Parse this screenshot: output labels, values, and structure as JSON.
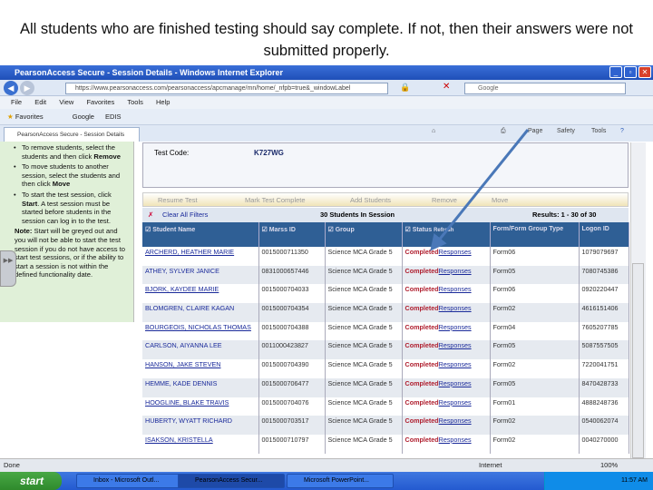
{
  "caption": "All students who are finished testing should say complete.  If not, then their answers were not submitted properly.",
  "browser": {
    "title": "PearsonAccess Secure - Session Details - Windows Internet Explorer",
    "url": "https://www.pearsonaccess.com/pearsonaccess/apcmanage/mn/home/_nfpb=true&_windowLabel",
    "search_placeholder": "Google",
    "menu": [
      "File",
      "Edit",
      "View",
      "Favorites",
      "Tools",
      "Help"
    ],
    "favorites": {
      "label": "Favorites",
      "items": [
        "Google",
        "EDIS"
      ]
    },
    "tab": "PearsonAccess Secure - Session Details",
    "commands": [
      "Page",
      "Safety",
      "Tools"
    ],
    "status": "Done",
    "zone": "Internet",
    "zoom": "100%"
  },
  "sidebar": {
    "items": [
      {
        "text": "To remove students, select the students and then click ",
        "bold": "Remove"
      },
      {
        "text": "To move students to another session, select the students and then click ",
        "bold": "Move"
      },
      {
        "text": "To start the test session, click ",
        "bold": "Start",
        "after": ". A test session must be started before students in the session can log in to the test."
      }
    ],
    "note_label": "Note:",
    "note": " Start will be greyed out and you will not be able to start the test session if you do not have access to start test sessions, or if the ability to start a session is not within the defined functionality date."
  },
  "session": {
    "test_code_label": "Test Code:",
    "test_code": "K727WG"
  },
  "toolbar": [
    "Resume Test",
    "Mark Test Complete",
    "Add Students",
    "Remove",
    "Move"
  ],
  "filters": {
    "clear": "Clear All Filters",
    "count": "30 Students In Session",
    "results": "Results: 1 - 30 of 30"
  },
  "columns": [
    "Student Name",
    "Marss ID",
    "Group",
    "Status",
    "Form/Form Group Type",
    "Logon ID"
  ],
  "refresh": "Refresh",
  "rows": [
    {
      "name": "ARCHERD, HEATHER MARIE",
      "id": "0015000711350",
      "group": "Science MCA Grade 5",
      "status": "Completed",
      "link": "Responses",
      "form": "Form06",
      "logon": "1079079697"
    },
    {
      "name": "ATHEY, SYLVER JANICE",
      "id": "0831000657446",
      "group": "Science MCA Grade 5",
      "status": "Completed",
      "link": "Responses",
      "form": "Form05",
      "logon": "7080745386"
    },
    {
      "name": "BJORK, KAYDEE MARIE",
      "id": "0015000704033",
      "group": "Science MCA Grade 5",
      "status": "Completed",
      "link": "Responses",
      "form": "Form06",
      "logon": "0920220447"
    },
    {
      "name": "BLOMGREN, CLAIRE KAGAN",
      "id": "0015000704354",
      "group": "Science MCA Grade 5",
      "status": "Completed",
      "link": "Responses",
      "form": "Form02",
      "logon": "4616151406"
    },
    {
      "name": "BOURGEOIS, NICHOLAS THOMAS",
      "id": "0015000704388",
      "group": "Science MCA Grade 5",
      "status": "Completed",
      "link": "Responses",
      "form": "Form04",
      "logon": "7605207785"
    },
    {
      "name": "CARLSON, AIYANNA LEE",
      "id": "0011000423827",
      "group": "Science MCA Grade 5",
      "status": "Completed",
      "link": "Responses",
      "form": "Form05",
      "logon": "5087557505"
    },
    {
      "name": "HANSON, JAKE STEVEN",
      "id": "0015000704390",
      "group": "Science MCA Grade 5",
      "status": "Completed",
      "link": "Responses",
      "form": "Form02",
      "logon": "7220041751"
    },
    {
      "name": "HEMME, KADE DENNIS",
      "id": "0015000706477",
      "group": "Science MCA Grade 5",
      "status": "Completed",
      "link": "Responses",
      "form": "Form05",
      "logon": "8470428733"
    },
    {
      "name": "HOOGLINE, BLAKE TRAVIS",
      "id": "0015000704076",
      "group": "Science MCA Grade 5",
      "status": "Completed",
      "link": "Responses",
      "form": "Form01",
      "logon": "4888248736"
    },
    {
      "name": "HUBERTY, WYATT RICHARD",
      "id": "0015000703517",
      "group": "Science MCA Grade 5",
      "status": "Completed",
      "link": "Responses",
      "form": "Form02",
      "logon": "0540062074"
    },
    {
      "name": "ISAKSON, KRISTELLA",
      "id": "0015000710797",
      "group": "Science MCA Grade 5",
      "status": "Completed",
      "link": "Responses",
      "form": "Form02",
      "logon": "0040270000"
    }
  ],
  "taskbar": {
    "start": "start",
    "tasks": [
      "Inbox - Microsoft Outl...",
      "PearsonAccess Secur...",
      "Microsoft PowerPoint..."
    ],
    "clock": "11:57 AM"
  }
}
